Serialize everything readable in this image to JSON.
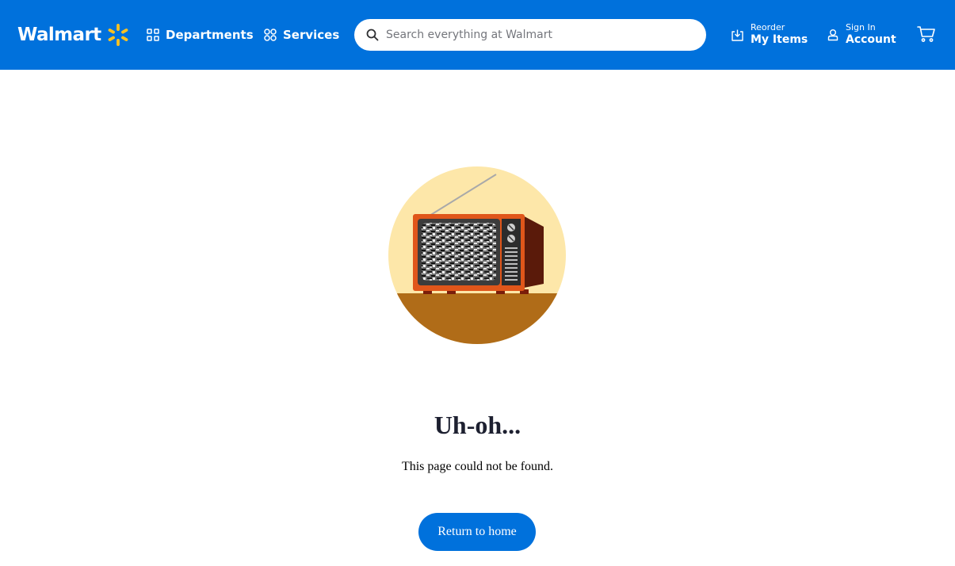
{
  "header": {
    "logo_text": "Walmart",
    "departments_label": "Departments",
    "services_label": "Services",
    "search_placeholder": "Search everything at Walmart",
    "reorder_small": "Reorder",
    "reorder_big": "My Items",
    "signin_small": "Sign In",
    "signin_big": "Account",
    "brand_color": "#0071dc",
    "spark_color": "#ffc220"
  },
  "icons": {
    "departments": "grid-icon",
    "services": "services-icon",
    "search": "search-icon",
    "reorder": "reorder-icon",
    "account": "user-icon",
    "cart": "cart-icon"
  },
  "error": {
    "title": "Uh-oh...",
    "message": "This page could not be found.",
    "button_label": "Return to home"
  }
}
